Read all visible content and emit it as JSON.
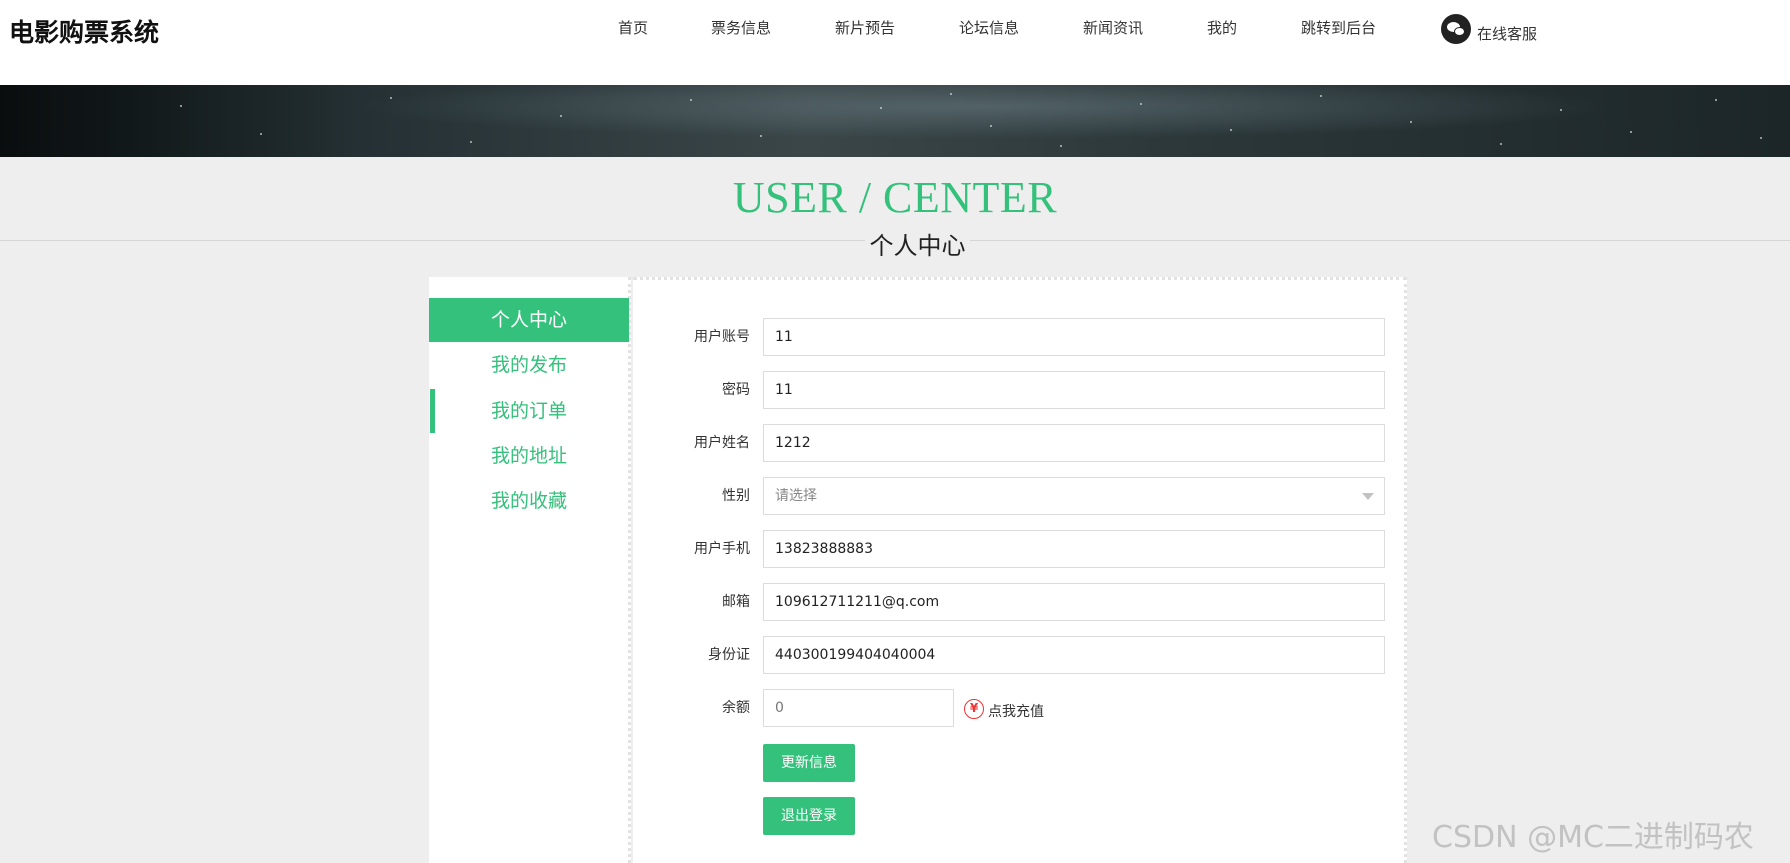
{
  "header": {
    "logo": "电影购票系统",
    "nav": [
      "首页",
      "票务信息",
      "新片预告",
      "论坛信息",
      "新闻资讯",
      "我的",
      "跳转到后台"
    ],
    "service_label": "在线客服",
    "service_icon": "wechat-icon"
  },
  "section": {
    "title_en": "USER / CENTER",
    "title_cn": "个人中心"
  },
  "sidebar": {
    "items": [
      {
        "label": "个人中心",
        "active": true
      },
      {
        "label": "我的发布",
        "active": false
      },
      {
        "label": "我的订单",
        "active": false
      },
      {
        "label": "我的地址",
        "active": false
      },
      {
        "label": "我的收藏",
        "active": false
      }
    ]
  },
  "form": {
    "fields": [
      {
        "label": "用户账号",
        "value": "11"
      },
      {
        "label": "密码",
        "value": "11"
      },
      {
        "label": "用户姓名",
        "value": "1212"
      },
      {
        "label": "性别",
        "placeholder": "请选择"
      },
      {
        "label": "用户手机",
        "value": "13823888883"
      },
      {
        "label": "邮箱",
        "value": "109612711211@q.com"
      },
      {
        "label": "身份证",
        "value": "440300199404040004"
      },
      {
        "label": "余额",
        "value": "0"
      }
    ],
    "recharge_label": "点我充值",
    "recharge_icon": "yen-icon",
    "update_button": "更新信息",
    "logout_button": "退出登录"
  },
  "watermark": "CSDN @MC二进制码农",
  "colors": {
    "accent": "#34c17b",
    "page_background": "#eeeeee"
  }
}
